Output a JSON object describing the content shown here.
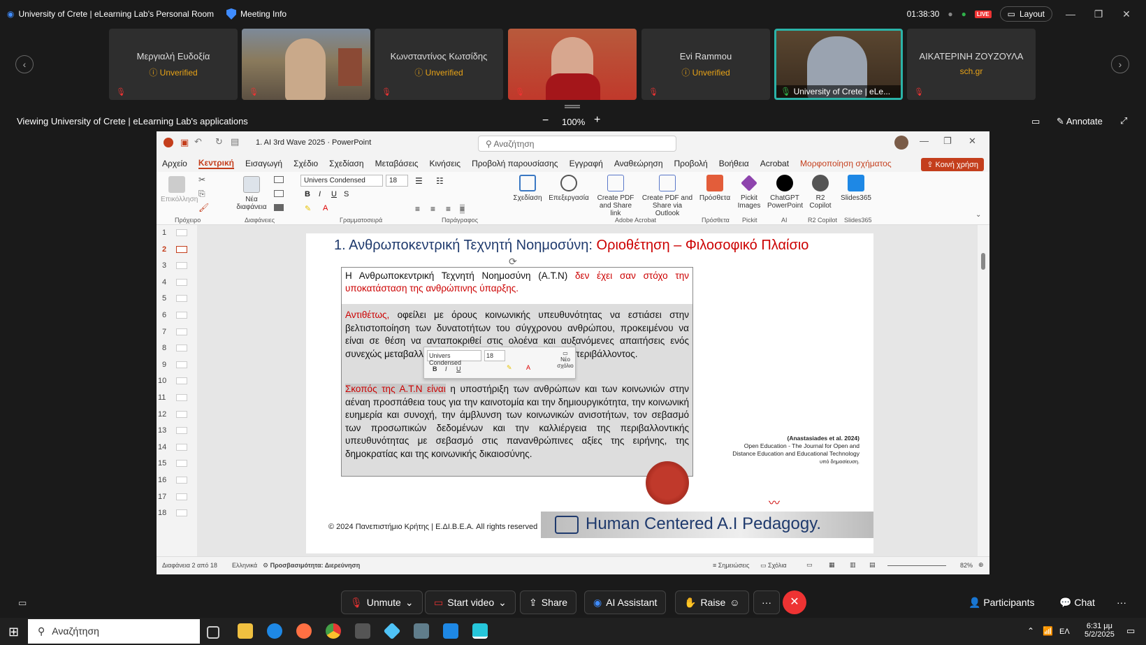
{
  "topbar": {
    "room_title": "University of Crete | eLearning Lab's Personal Room",
    "meeting_info": "Meeting Info",
    "timer": "01:38:30",
    "live": "LIVE",
    "layout": "Layout"
  },
  "participants": [
    {
      "name": "Μεργιαλή Ευδοξία",
      "status": "Unverified"
    },
    {
      "name": "",
      "status": ""
    },
    {
      "name": "Κωνσταντίνος Κωτσίδης",
      "status": "Unverified"
    },
    {
      "name": "",
      "status": ""
    },
    {
      "name": "Evi Rammou",
      "status": "Unverified"
    },
    {
      "name": "University of Crete | eLe...",
      "status": ""
    },
    {
      "name": "ΑΙΚΑΤΕΡΙΝΗ ΖΟΥΖΟΥΛΑ",
      "status": "sch.gr"
    }
  ],
  "viewbar": {
    "viewing": "Viewing University of Crete | eLearning Lab's applications",
    "zoom": "100%",
    "annotate": "Annotate"
  },
  "ppt": {
    "file_title": "1. AI 3rd Wave 2025 · PowerPoint",
    "search_placeholder": "Αναζήτηση",
    "menu": [
      "Αρχείο",
      "Κεντρική",
      "Εισαγωγή",
      "Σχέδιο",
      "Σχεδίαση",
      "Μεταβάσεις",
      "Κινήσεις",
      "Προβολή παρουσίασης",
      "Εγγραφή",
      "Αναθεώρηση",
      "Προβολή",
      "Βοήθεια",
      "Acrobat",
      "Μορφοποίηση σχήματος"
    ],
    "share": "Κοινή χρήση",
    "ribbon": {
      "paste": "Επικόλληση",
      "new_slide": "Νέα διαφάνεια",
      "font": "Univers Condensed",
      "size": "18",
      "design": "Σχεδίαση",
      "edit": "Επεξεργασία",
      "pdf1": "Create PDF and Share link",
      "pdf2": "Create PDF and Share via Outlook",
      "addins": "Πρόσθετα",
      "pickit": "Pickit Images",
      "chatgpt": "ChatGPT PowerPoint",
      "r2": "R2 Copilot",
      "slides365": "Slides365",
      "groups": [
        "Πρόχειρο",
        "Διαφάνειες",
        "Γραμματοσειρά",
        "Παράγραφος",
        "Adobe Acrobat",
        "Πρόσθετα",
        "Pickit",
        "AI",
        "R2 Copilot",
        "Slides365"
      ]
    },
    "thumb_numbers": [
      "1",
      "2",
      "3",
      "4",
      "5",
      "6",
      "7",
      "8",
      "9",
      "10",
      "11",
      "12",
      "13",
      "14",
      "15",
      "16",
      "17",
      "18"
    ],
    "status": {
      "slide": "Διαφάνεια 2 από 18",
      "lang": "Ελληνικά",
      "access": "Προσβασιμότητα: Διερεύνηση",
      "notes": "Σημειώσεις",
      "comments": "Σχόλια",
      "zoom": "82%"
    }
  },
  "slide": {
    "title_black": "1.  Ανθρωποκεντρική Τεχνητή Νοημοσύνη:",
    "title_red": "Οριοθέτηση – Φιλοσοφικό Πλαίσιο",
    "p1_black": "Η Ανθρωποκεντρική Τεχνητή Νοημοσύνη (Α.Τ.Ν)",
    "p1_red": "δεν  έχει σαν στόχο την υποκατάσταση της ανθρώπινης ύπαρξης.",
    "p2_red": "Αντιθέτως,",
    "p2_rest": "οφείλει με όρους κοινωνικής υπευθυνότητας να εστιάσει στην βελτιστοποίηση των δυνατοτήτων του σύγχρονου ανθρώπου, προκειμένου να είναι σε θέση να ανταποκριθεί στις ολοένα και αυξανόμενες απαιτήσεις ενός συνεχώς μεταβαλλόμενου κ                                                      ονομικού και πολιτισμικού περιβάλλοντος.",
    "p3_hl": "Σκοπός της Α.Τ.Ν είναι",
    "p3_rest": " η υποστήριξη των ανθρώπων και των κοινωνιών στην αέναη προσπάθεια τους για την καινοτομία και την δημιουργικότητα, την κοινωνική ευημερία και συνοχή, την άμβλυνση των κοινωνικών ανισοτήτων, τον σεβασμό των προσωπικών δεδομένων και την καλλιέργεια της περιβαλλοντικής υπευθυνότητας με σεβασμό στις πανανθρώπινες αξίες της ειρήνης, της δημοκρατίας και της κοινωνικής δικαιοσύνης.",
    "ref1": "(Anastasiades et al. 2024)",
    "ref2": "Open Education - The Journal for Open and",
    "ref3": "Distance Education and Educational Technology",
    "ref4": "υπό δημοσίευση.",
    "footer": "© 2024    Πανεπιστήμιο Κρήτης | Ε.ΔΙ.Β.Ε.Α.  All rights reserved",
    "banner": "Human Centered A.I Pedagogy.",
    "mini_font": "Univers Condensed",
    "mini_size": "18",
    "mini_comment": "Νέο σχόλιο"
  },
  "bottombar": {
    "unmute": "Unmute",
    "start_video": "Start video",
    "share": "Share",
    "ai": "AI Assistant",
    "raise": "Raise",
    "participants": "Participants",
    "chat": "Chat"
  },
  "taskbar": {
    "search": "Αναζήτηση",
    "lang": "ΕΛ",
    "time": "6:31 μμ",
    "date": "5/2/2025"
  }
}
